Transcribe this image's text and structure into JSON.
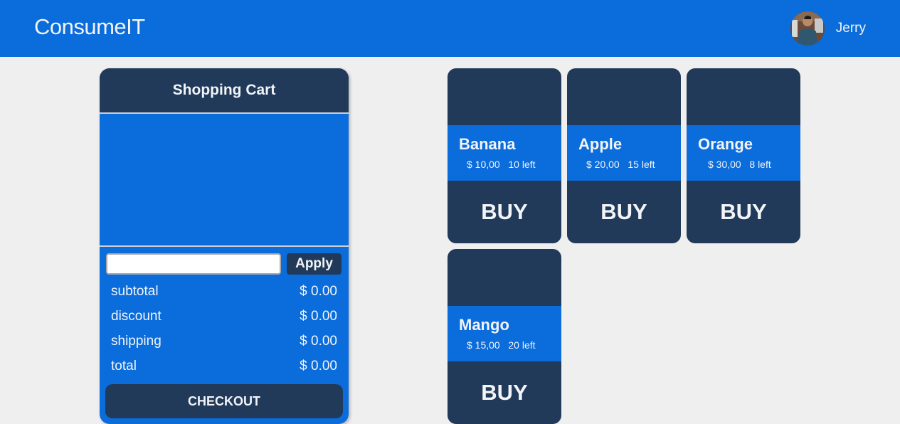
{
  "header": {
    "brand": "ConsumeIT",
    "user_name": "Jerry",
    "avatar_icon": "user-avatar-photo"
  },
  "cart": {
    "title": "Shopping Cart",
    "coupon_value": "",
    "coupon_placeholder": "",
    "apply_label": "Apply",
    "summary": [
      {
        "label": "subtotal",
        "value": "$ 0.00"
      },
      {
        "label": "discount",
        "value": "$ 0.00"
      },
      {
        "label": "shipping",
        "value": "$ 0.00"
      },
      {
        "label": "total",
        "value": "$ 0.00"
      }
    ],
    "checkout_label": "CHECKOUT"
  },
  "products": [
    {
      "name": "Banana",
      "price": "$ 10,00",
      "stock": "10 left",
      "buy_label": "BUY"
    },
    {
      "name": "Apple",
      "price": "$ 20,00",
      "stock": "15 left",
      "buy_label": "BUY"
    },
    {
      "name": "Orange",
      "price": "$ 30,00",
      "stock": "8 left",
      "buy_label": "BUY"
    },
    {
      "name": "Mango",
      "price": "$ 15,00",
      "stock": "20 left",
      "buy_label": "BUY"
    }
  ],
  "colors": {
    "primary": "#0b6cdb",
    "dark": "#213a5a",
    "background": "#efefef",
    "text_light": "#f2f4f7"
  }
}
